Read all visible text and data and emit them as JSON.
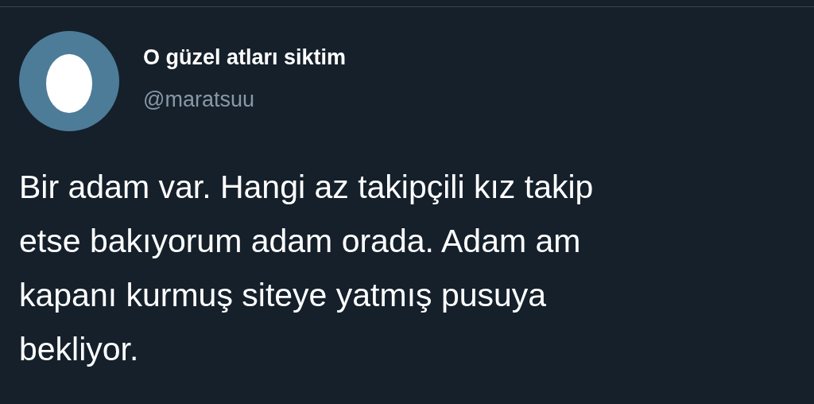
{
  "tweet": {
    "author": {
      "name": "O güzel atları siktim",
      "handle": "@maratsuu",
      "avatar": {
        "kind": "default-egg"
      }
    },
    "text_lines": [
      "Bir adam var. Hangi az takipçili kız takip",
      "etse bakıyorum adam orada. Adam am",
      "kapanı kurmuş siteye yatmış pusuya",
      "bekliyor."
    ]
  }
}
